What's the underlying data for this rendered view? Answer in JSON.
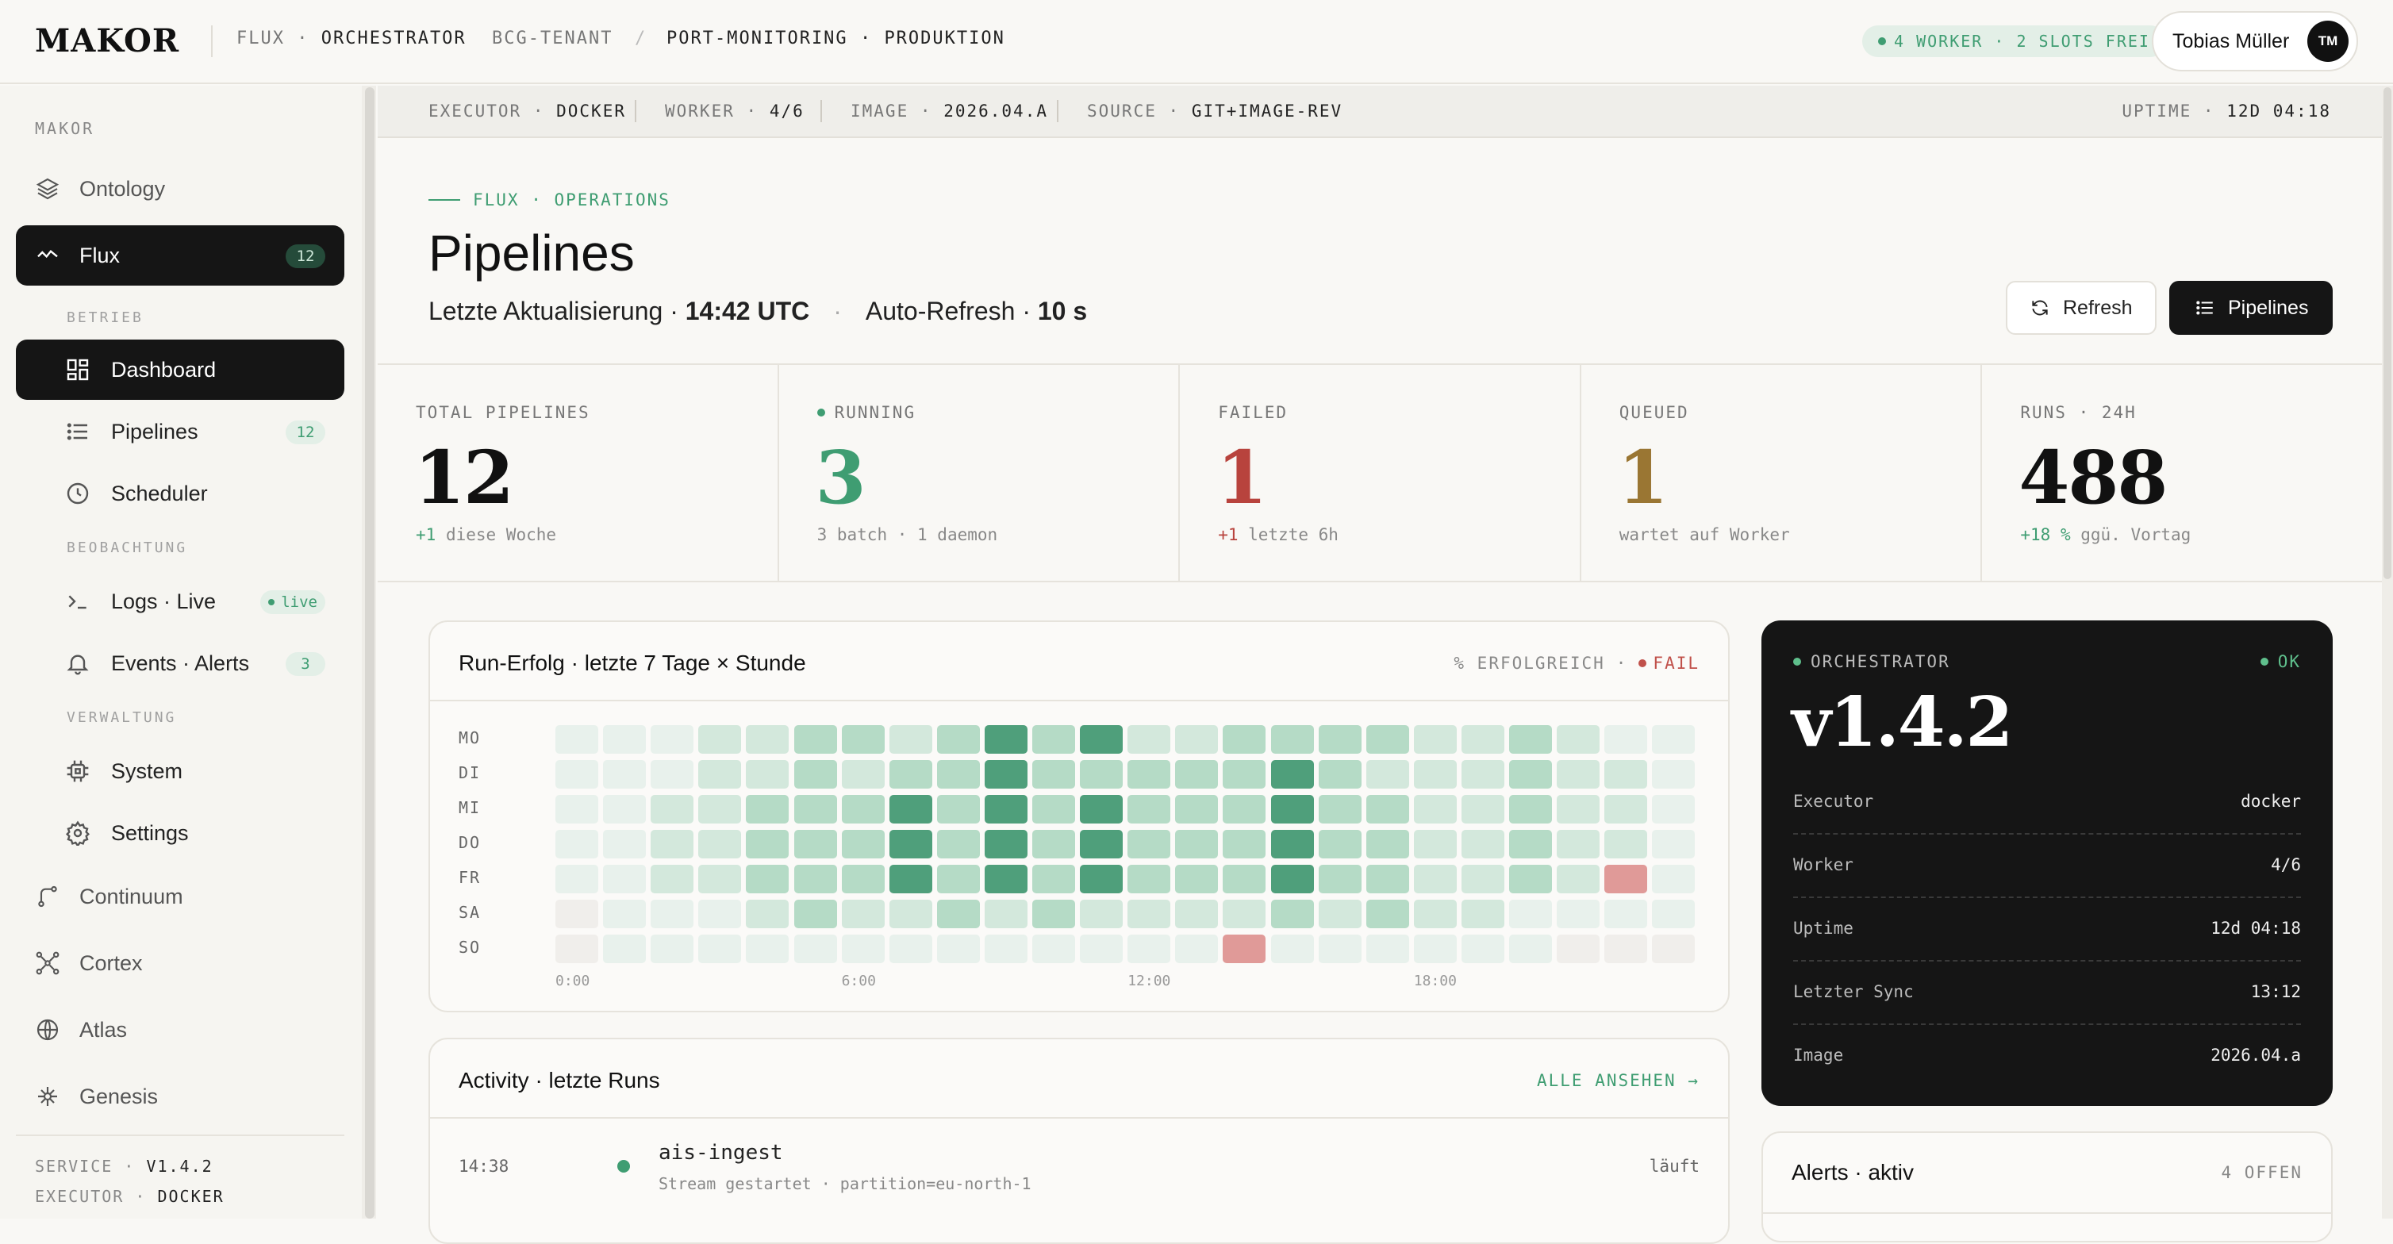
{
  "topbar": {
    "logo": "MAKOR",
    "crumb1_a": "FLUX",
    "crumb1_sep": "·",
    "crumb1_b": "ORCHESTRATOR",
    "tenant": "BCG-TENANT",
    "slash": "/",
    "crumb3_a": "PORT-MONITORING",
    "crumb3_sep": "·",
    "crumb3_b": "PRODUKTION",
    "worker_status": "4 WORKER · 2 SLOTS FREI",
    "user_name": "Tobias Müller",
    "user_initials": "TM"
  },
  "sidebar": {
    "section": "MAKOR",
    "items": {
      "ontology": "Ontology",
      "flux": "Flux",
      "flux_badge": "12",
      "group_betrieb": "BETRIEB",
      "dashboard": "Dashboard",
      "pipelines": "Pipelines",
      "pipelines_badge": "12",
      "scheduler": "Scheduler",
      "group_beobachtung": "BEOBACHTUNG",
      "logs": "Logs · Live",
      "logs_badge": "live",
      "events": "Events · Alerts",
      "events_badge": "3",
      "group_verwaltung": "VERWALTUNG",
      "system": "System",
      "settings": "Settings",
      "continuum": "Continuum",
      "cortex": "Cortex",
      "atlas": "Atlas",
      "genesis": "Genesis"
    },
    "footer": {
      "service_k": "SERVICE",
      "service_v": "V1.4.2",
      "executor_k": "EXECUTOR",
      "executor_v": "DOCKER",
      "sep": "·"
    }
  },
  "infobar": {
    "executor_k": "EXECUTOR",
    "executor_v": "DOCKER",
    "worker_k": "WORKER",
    "worker_v": "4/6",
    "image_k": "IMAGE",
    "image_v": "2026.04.A",
    "source_k": "SOURCE",
    "source_v": "GIT+IMAGE-REV",
    "uptime_k": "UPTIME",
    "uptime_v": "12D 04:18",
    "sep": "·"
  },
  "header": {
    "eyebrow": "FLUX · OPERATIONS",
    "title": "Pipelines",
    "updated_label": "Letzte Aktualisierung · ",
    "updated_value": "14:42 UTC",
    "mid_dot": "·",
    "refresh_label": "Auto-Refresh · ",
    "refresh_value": "10 s",
    "btn_refresh": "Refresh",
    "btn_pipelines": "Pipelines"
  },
  "stats": [
    {
      "key": "TOTAL PIPELINES",
      "value": "12",
      "sub_hl": "+1",
      "sub": " diese Woche",
      "color": "#111111",
      "hl_color": "#3f9d72",
      "dot": false
    },
    {
      "key": "RUNNING",
      "value": "3",
      "sub_hl": "",
      "sub": "3 batch · 1 daemon",
      "color": "#3f9d72",
      "hl_color": "#3f9d72",
      "dot": true
    },
    {
      "key": "FAILED",
      "value": "1",
      "sub_hl": "+1",
      "sub": " letzte 6h",
      "color": "#b8433d",
      "hl_color": "#b8433d",
      "dot": false
    },
    {
      "key": "QUEUED",
      "value": "1",
      "sub_hl": "",
      "sub": "wartet auf Worker",
      "color": "#9a7633",
      "hl_color": "#9a7633",
      "dot": false
    },
    {
      "key": "RUNS · 24H",
      "value": "488",
      "sub_hl": "+18 %",
      "sub": " ggü. Vortag",
      "color": "#111111",
      "hl_color": "#3f9d72",
      "dot": false
    }
  ],
  "heatmap": {
    "title": "Run-Erfolg · letzte 7 Tage × Stunde",
    "legend_ok": "% ERFOLGREICH",
    "legend_sep": "·",
    "legend_fail": "FAIL",
    "days": [
      "MO",
      "DI",
      "MI",
      "DO",
      "FR",
      "SA",
      "SO"
    ],
    "ticks": [
      "0:00",
      "6:00",
      "12:00",
      "18:00"
    ],
    "palette": [
      "#f0eeeb",
      "#e8f1ec",
      "#d3e8dc",
      "#b5dbc6",
      "#9fd0b6",
      "#4f9f7b",
      "#e09a98"
    ],
    "levels": [
      [
        1,
        1,
        1,
        2,
        2,
        3,
        3,
        2,
        3,
        5,
        3,
        5,
        2,
        2,
        3,
        3,
        3,
        3,
        2,
        2,
        3,
        2,
        1,
        1
      ],
      [
        1,
        1,
        1,
        2,
        2,
        3,
        2,
        3,
        3,
        5,
        3,
        3,
        3,
        3,
        3,
        5,
        3,
        2,
        2,
        2,
        3,
        2,
        2,
        1
      ],
      [
        1,
        1,
        2,
        2,
        3,
        3,
        3,
        5,
        3,
        5,
        3,
        5,
        3,
        3,
        3,
        5,
        3,
        3,
        2,
        2,
        3,
        2,
        2,
        1
      ],
      [
        1,
        1,
        2,
        2,
        3,
        3,
        3,
        5,
        3,
        5,
        3,
        5,
        3,
        3,
        3,
        5,
        3,
        3,
        2,
        2,
        3,
        2,
        2,
        1
      ],
      [
        1,
        1,
        2,
        2,
        3,
        3,
        3,
        5,
        3,
        5,
        3,
        5,
        3,
        3,
        3,
        5,
        3,
        3,
        2,
        2,
        3,
        2,
        6,
        1
      ],
      [
        0,
        1,
        1,
        1,
        2,
        3,
        2,
        2,
        3,
        2,
        3,
        2,
        2,
        2,
        2,
        3,
        2,
        3,
        2,
        2,
        1,
        1,
        1,
        1
      ],
      [
        0,
        1,
        1,
        1,
        1,
        1,
        1,
        1,
        1,
        1,
        1,
        1,
        1,
        1,
        6,
        1,
        1,
        1,
        1,
        1,
        1,
        0,
        0,
        0
      ]
    ]
  },
  "activity": {
    "title": "Activity · letzte Runs",
    "link": "ALLE ANSEHEN →",
    "rows": [
      {
        "time": "14:38",
        "name": "ais-ingest",
        "sub": "Stream gestartet · partition=eu-north-1",
        "status": "läuft"
      }
    ]
  },
  "orchestrator": {
    "label": "ORCHESTRATOR",
    "status": "OK",
    "version": "v1.4.2",
    "rows": [
      {
        "k": "Executor",
        "v": "docker"
      },
      {
        "k": "Worker",
        "v": "4/6"
      },
      {
        "k": "Uptime",
        "v": "12d 04:18"
      },
      {
        "k": "Letzter Sync",
        "v": "13:12"
      },
      {
        "k": "Image",
        "v": "2026.04.a"
      }
    ]
  },
  "alerts": {
    "title": "Alerts · aktiv",
    "count": "4 OFFEN"
  }
}
